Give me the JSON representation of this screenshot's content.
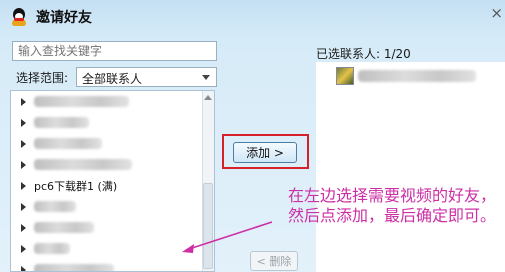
{
  "window": {
    "title": "邀请好友",
    "close_glyph": "×"
  },
  "search": {
    "placeholder": "输入查找关键字"
  },
  "range": {
    "label": "选择范围:",
    "value": "全部联系人"
  },
  "contacts": {
    "named_group": "pc6下载群1 (满)"
  },
  "selected": {
    "label": "已选联系人: 1/20"
  },
  "buttons": {
    "add": "添加 >",
    "remove": "< 删除"
  },
  "annotation": {
    "text": "在左边选择需要视频的好友，然后点添加，最后确定即可。"
  },
  "colors": {
    "highlight_frame": "#d8202a",
    "annotation_text": "#cc2fa6"
  }
}
